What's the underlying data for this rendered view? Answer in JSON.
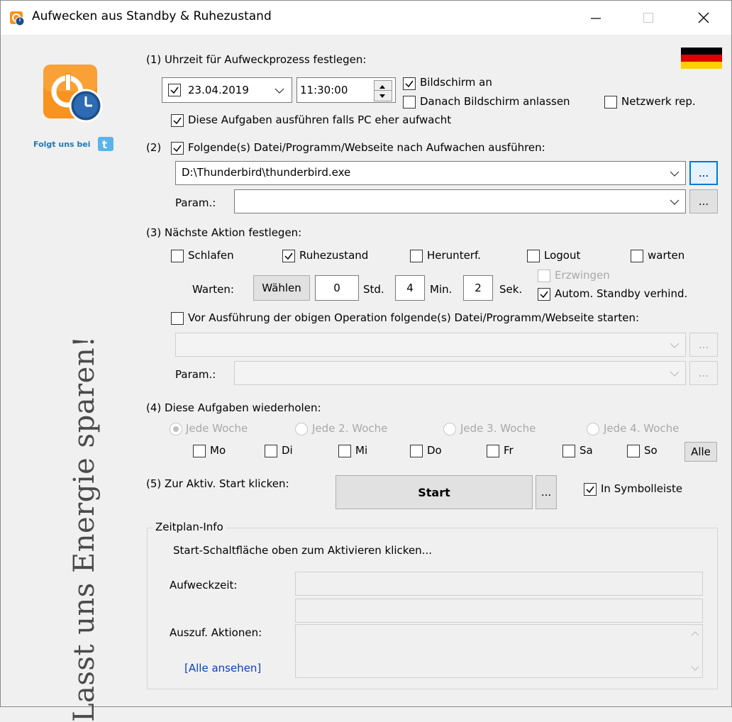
{
  "window": {
    "title": "Aufwecken aus Standby & Ruhezustand"
  },
  "sidebar": {
    "follow_text": "Folgt uns bei",
    "slogan": "Lasst uns Energie sparen!"
  },
  "section1": {
    "heading": "(1) Uhrzeit für Aufweckprozess festlegen:",
    "date": "23.04.2019",
    "time": "11:30:00",
    "screen_on": "Bildschirm an",
    "keep_screen_on": "Danach Bildschirm anlassen",
    "network_repair": "Netzwerk rep.",
    "run_if_earlier": "Diese Aufgaben ausführen falls PC eher aufwacht"
  },
  "section2": {
    "prefix": "(2)",
    "heading": "Folgende(s) Datei/Programm/Webseite nach Aufwachen ausführen:",
    "path": "D:\\Thunderbird\\thunderbird.exe",
    "param_label": "Param.:",
    "browse": "...",
    "param_value": ""
  },
  "section3": {
    "heading": "(3) Nächste Aktion festlegen:",
    "actions": [
      "Schlafen",
      "Ruhezustand",
      "Herunterf.",
      "Logout",
      "warten"
    ],
    "wait_label": "Warten:",
    "choose_button": "Wählen",
    "hours": "0",
    "hours_unit": "Std.",
    "minutes": "4",
    "minutes_unit": "Min.",
    "seconds": "2",
    "seconds_unit": "Sek.",
    "force": "Erzwingen",
    "prevent_standby": "Autom. Standby verhind.",
    "before_run": "Vor Ausführung der obigen Operation folgende(s) Datei/Programm/Webseite starten:",
    "param_label": "Param.:",
    "browse": "..."
  },
  "section4": {
    "heading": "(4) Diese Aufgaben wiederholen:",
    "weeks": [
      "Jede Woche",
      "Jede 2. Woche",
      "Jede 3. Woche",
      "Jede 4. Woche"
    ],
    "days": [
      "Mo",
      "Di",
      "Mi",
      "Do",
      "Fr",
      "Sa",
      "So"
    ],
    "all_button": "Alle"
  },
  "section5": {
    "heading": "(5) Zur Aktiv. Start klicken:",
    "start_button": "Start",
    "more_button": "...",
    "in_tray": "In Symbolleiste"
  },
  "info": {
    "legend": "Zeitplan-Info",
    "hint": "Start-Schaltfläche oben zum Aktivieren klicken...",
    "wake_label": "Aufweckzeit:",
    "actions_label": "Auszuf. Aktionen:",
    "view_all": "[Alle ansehen]"
  },
  "colors": {
    "accent": "#0078d7",
    "link": "#0b3fb8",
    "logo_orange": "#f7931e"
  }
}
